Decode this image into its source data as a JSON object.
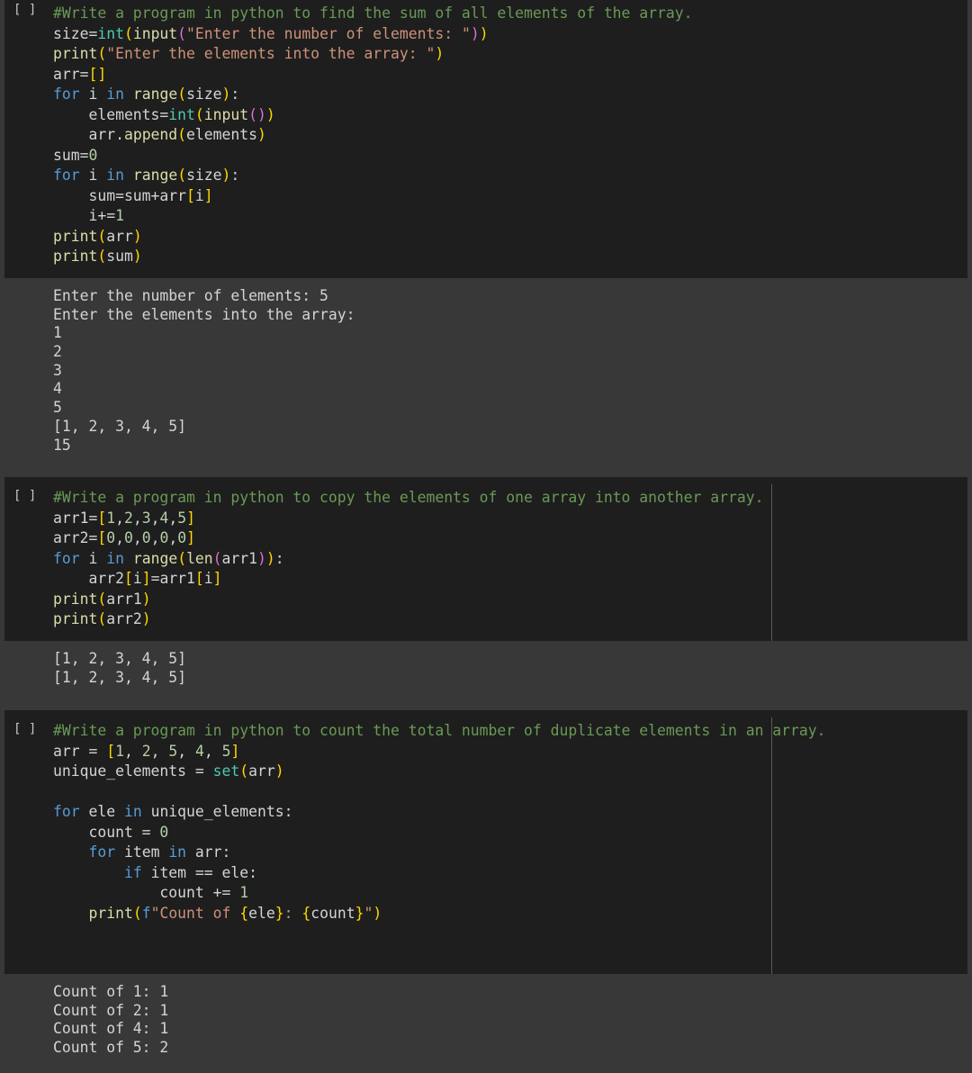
{
  "cells": [
    {
      "run_label": "[ ]",
      "code": [
        "#Write a program in python to find the sum of all elements of the array.",
        "size=int(input(\"Enter the number of elements: \"))",
        "print(\"Enter the elements into the array: \")",
        "arr=[]",
        "for i in range(size):",
        "    elements=int(input())",
        "    arr.append(elements)",
        "sum=0",
        "for i in range(size):",
        "    sum=sum+arr[i]",
        "    i+=1",
        "print(arr)",
        "print(sum)"
      ],
      "output": [
        "Enter the number of elements: 5",
        "Enter the elements into the array:",
        "1",
        "2",
        "3",
        "4",
        "5",
        "[1, 2, 3, 4, 5]",
        "15"
      ]
    },
    {
      "run_label": "[ ]",
      "code": [
        "#Write a program in python to copy the elements of one array into another array.",
        "arr1=[1,2,3,4,5]",
        "arr2=[0,0,0,0,0]",
        "for i in range(len(arr1)):",
        "    arr2[i]=arr1[i]",
        "print(arr1)",
        "print(arr2)"
      ],
      "output": [
        "[1, 2, 3, 4, 5]",
        "[1, 2, 3, 4, 5]"
      ]
    },
    {
      "run_label": "[ ]",
      "code": [
        "#Write a program in python to count the total number of duplicate elements in an array.",
        "arr = [1, 2, 5, 4, 5]",
        "unique_elements = set(arr)",
        "",
        "for ele in unique_elements:",
        "    count = 0",
        "    for item in arr:",
        "        if item == ele:",
        "            count += 1",
        "    print(f\"Count of {ele}: {count}\")"
      ],
      "output": [
        "Count of 1: 1",
        "Count of 2: 1",
        "Count of 4: 1",
        "Count of 5: 2"
      ]
    }
  ]
}
